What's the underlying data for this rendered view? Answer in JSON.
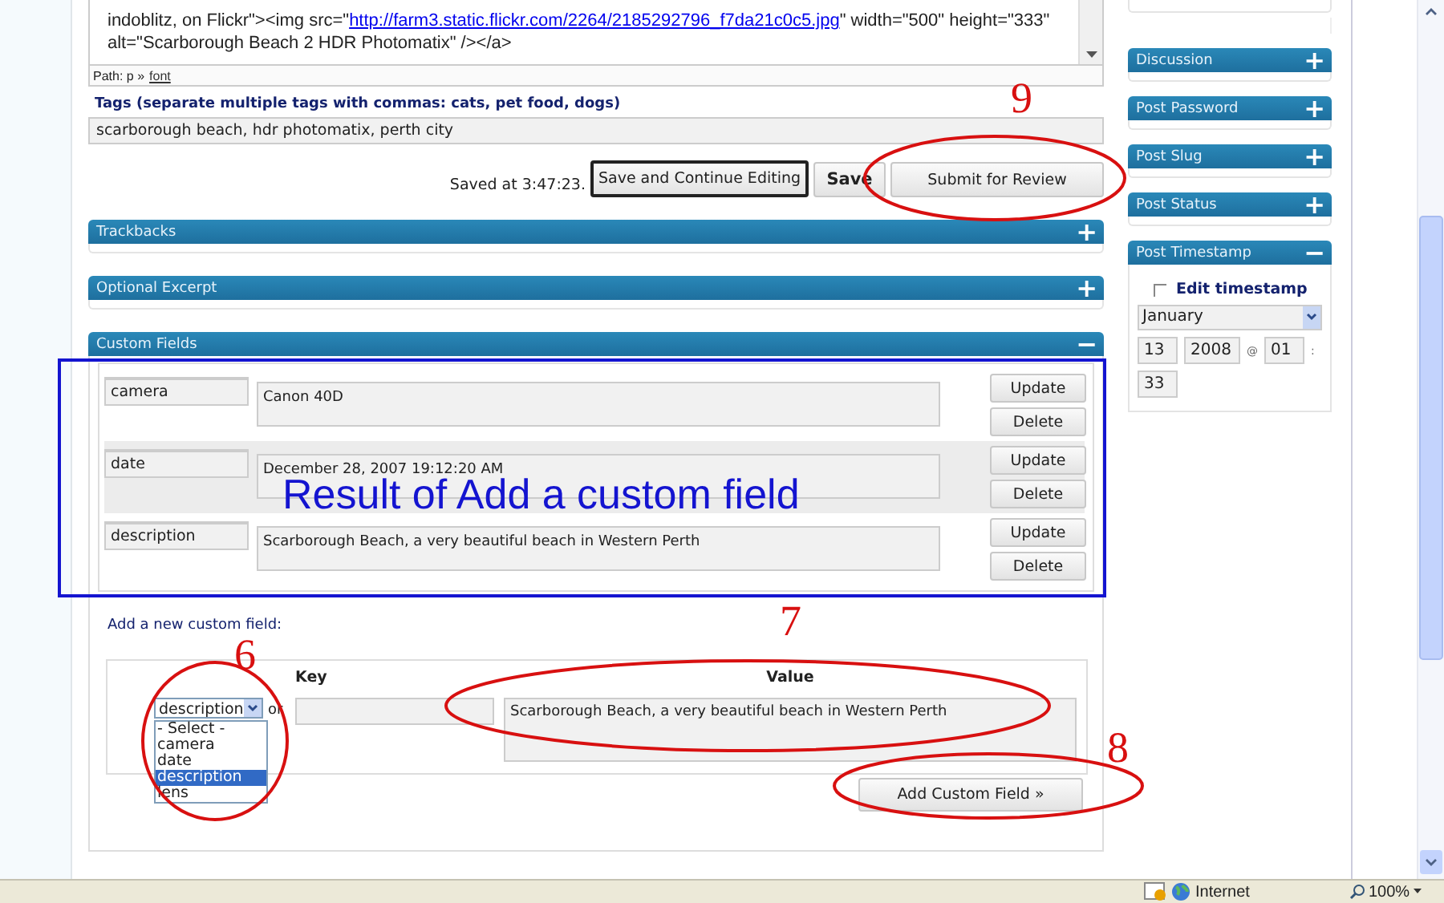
{
  "editor": {
    "line_2_before_link": "indoblitz, on Flickr\"><img src=\"",
    "line_2_link": "http://farm3.static.flickr.com/2264/2185292796_f7da21c0c5.jpg",
    "line_2_after_link": "\" width=\"500\" height=\"333\"",
    "line_3": "alt=\"Scarborough Beach 2 HDR Photomatix\" /></a>",
    "path_label": "Path: p »",
    "path_link": "font"
  },
  "tags": {
    "label": "Tags (separate multiple tags with commas: cats, pet food, dogs)",
    "value": "scarborough beach, hdr photomatix, perth city"
  },
  "saved_text": "Saved at 3:47:23.",
  "buttons": [
    {
      "label": "Save and Continue Editing",
      "kind": "framed"
    },
    {
      "label": "Save",
      "kind": "bold"
    },
    {
      "label": "Submit for Review",
      "kind": "plain"
    }
  ],
  "panels": [
    {
      "title": "Trackbacks",
      "toggle": "+"
    },
    {
      "title": "Optional Excerpt",
      "toggle": "+"
    },
    {
      "title": "Custom Fields",
      "toggle": "−"
    }
  ],
  "custom_fields": [
    {
      "key": "camera",
      "value": "Canon 40D",
      "highlighted": false,
      "update": "Update",
      "delete": "Delete"
    },
    {
      "key": "date",
      "value": "December 28, 2007 19:12:20 AM",
      "highlighted": true,
      "update": "Update",
      "delete": "Delete"
    },
    {
      "key": "description",
      "value": "Scarborough Beach, a very beautiful beach in Western Perth",
      "highlighted": false,
      "update": "Update",
      "delete": "Delete"
    }
  ],
  "new_field": {
    "label": "Add a new custom field:",
    "key_heading": "Key",
    "value_heading": "Value",
    "select_value": "description",
    "or": "or",
    "value": "Scarborough Beach, a very beautiful beach in Western Perth",
    "button": "Add Custom Field »",
    "options": [
      {
        "label": "- Select -",
        "selected": false
      },
      {
        "label": "camera",
        "selected": false
      },
      {
        "label": "date",
        "selected": false
      },
      {
        "label": "description",
        "selected": true
      },
      {
        "label": "lens",
        "selected": false
      }
    ]
  },
  "sidebar_panels": [
    {
      "title": "Discussion",
      "toggle": "+"
    },
    {
      "title": "Post Password",
      "toggle": "+"
    },
    {
      "title": "Post Slug",
      "toggle": "+"
    },
    {
      "title": "Post Status",
      "toggle": "+"
    },
    {
      "title": "Post Timestamp",
      "toggle": "−"
    }
  ],
  "timestamp": {
    "checkbox_label": "Edit timestamp",
    "checked": false,
    "month": "January",
    "day": "13",
    "year": "2008",
    "at": "@",
    "hour": "01",
    "colon": ":",
    "minute": "33"
  },
  "annotations": {
    "frame_label": "Result of Add a custom field",
    "numbers": [
      "6",
      "7",
      "8",
      "9"
    ]
  },
  "status_bar": {
    "zone": "Internet",
    "zoom": "100%"
  }
}
